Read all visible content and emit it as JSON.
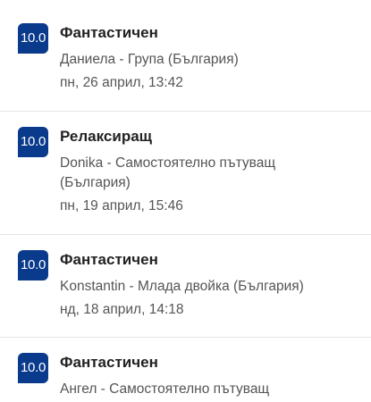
{
  "reviews": [
    {
      "score": "10.0",
      "title": "Фантастичен",
      "reviewer_lines": [
        "Даниела - Група (България)"
      ],
      "date": "пн, 26 април, 13:42"
    },
    {
      "score": "10.0",
      "title": "Релаксиращ",
      "reviewer_lines": [
        "Donika - Самостоятелно пътуващ",
        "(България)"
      ],
      "date": "пн, 19 април, 15:46"
    },
    {
      "score": "10.0",
      "title": "Фантастичен",
      "reviewer_lines": [
        "Konstantin - Млада двойка (България)"
      ],
      "date": "нд, 18 април, 14:18"
    },
    {
      "score": "10.0",
      "title": "Фантастичен",
      "reviewer_lines": [
        "Ангел - Самостоятелно пътуващ"
      ],
      "date": ""
    }
  ],
  "colors": {
    "badge": "#0a3a8c",
    "title": "#222222",
    "meta": "#555555"
  }
}
